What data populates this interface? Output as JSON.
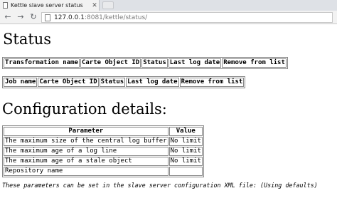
{
  "browser": {
    "tab_title": "Kettle slave server status",
    "url_host": "127.0.0.1",
    "url_rest": ":8081/kettle/status/",
    "back_icon": "arrow-left-icon",
    "forward_icon": "arrow-right-icon",
    "reload_icon": "reload-icon"
  },
  "page": {
    "title": "Status",
    "transformations_table": {
      "headers": [
        "Transformation name",
        "Carte Object ID",
        "Status",
        "Last log date",
        "Remove from list"
      ]
    },
    "jobs_table": {
      "headers": [
        "Job name",
        "Carte Object ID",
        "Status",
        "Last log date",
        "Remove from list"
      ]
    },
    "config_title": "Configuration details:",
    "config_table": {
      "headers": [
        "Parameter",
        "Value"
      ],
      "rows": [
        [
          "The maximum size of the central log buffer",
          "No limit"
        ],
        [
          "The maximum age of a log line",
          "No limit"
        ],
        [
          "The maximum age of a stale object",
          "No limit"
        ],
        [
          "Repository name",
          ""
        ]
      ]
    },
    "note": "These parameters can be set in the slave server configuration XML file: (Using defaults)"
  }
}
